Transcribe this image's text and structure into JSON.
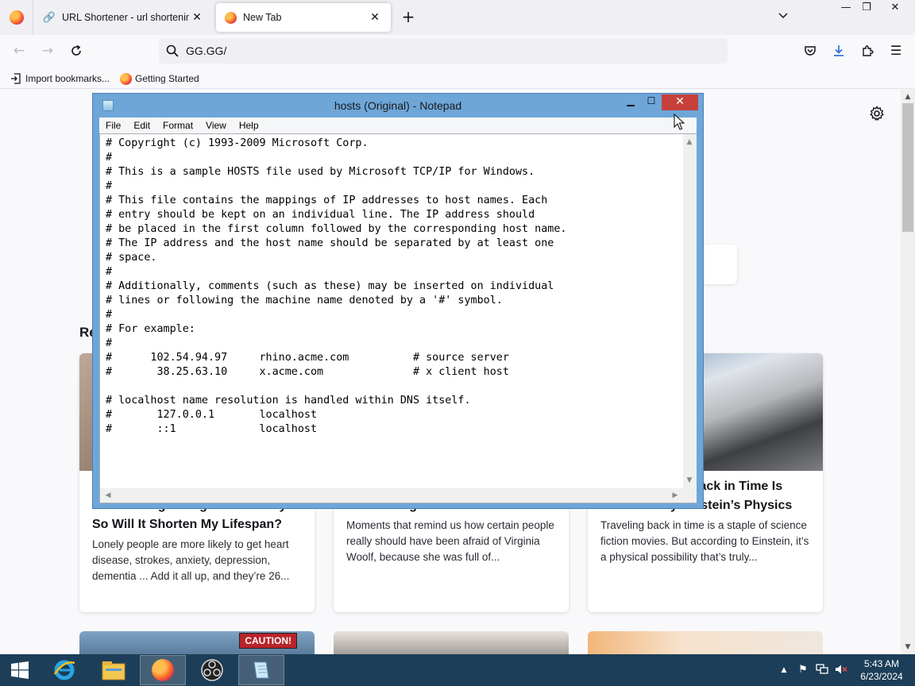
{
  "browser": {
    "tabs": [
      {
        "label": "URL Shortener - url shortening"
      },
      {
        "label": "New Tab"
      }
    ],
    "address": "GG.GG/",
    "bookmarks": [
      {
        "label": "Import bookmarks..."
      },
      {
        "label": "Getting Started"
      }
    ]
  },
  "newtab": {
    "section_title": "Re",
    "cards": [
      {
        "title": "The Loneliness Trap: It Is As Bad As Smoking 15 Cigarettes a Day. So Will It Shorten My Lifespan?",
        "description": "Lonely people are more likely to get heart disease, strokes, anxiety, depression, dementia ... Add it all up, and they’re 26..."
      },
      {
        "title": "A Selection of Virginia Woolf’s Most Savage Insults",
        "description": "Moments that remind us how certain people really should have been afraid of Virginia Woolf, because she was full of..."
      },
      {
        "title": "How Traveling Back in Time Is Permitted by Einstein’s Physics",
        "description": "Traveling back in time is a staple of science fiction movies. But according to Einstein, it’s a physical possibility that’s truly..."
      }
    ],
    "bottom_badge": "CAUTION!"
  },
  "notepad": {
    "title": "hosts (Original) - Notepad",
    "menu": [
      "File",
      "Edit",
      "Format",
      "View",
      "Help"
    ],
    "content": "# Copyright (c) 1993-2009 Microsoft Corp.\n#\n# This is a sample HOSTS file used by Microsoft TCP/IP for Windows.\n#\n# This file contains the mappings of IP addresses to host names. Each\n# entry should be kept on an individual line. The IP address should\n# be placed in the first column followed by the corresponding host name.\n# The IP address and the host name should be separated by at least one\n# space.\n#\n# Additionally, comments (such as these) may be inserted on individual\n# lines or following the machine name denoted by a '#' symbol.\n#\n# For example:\n#\n#      102.54.94.97     rhino.acme.com          # source server\n#       38.25.63.10     x.acme.com              # x client host\n\n# localhost name resolution is handled within DNS itself.\n#       127.0.0.1       localhost\n#       ::1             localhost"
  },
  "taskbar": {
    "time": "5:43 AM",
    "date": "6/23/2024"
  }
}
